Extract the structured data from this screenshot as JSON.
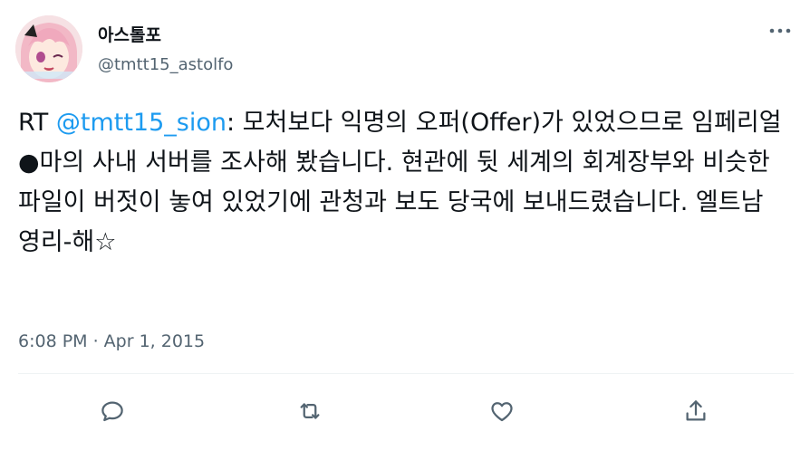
{
  "user": {
    "display_name": "아스톨포",
    "handle": "@tmtt15_astolfo",
    "avatar_icon": "anime-avatar"
  },
  "tweet": {
    "prefix": "RT ",
    "mention": "@tmtt15_sion",
    "body": ": 모처보다 익명의 오퍼(Offer)가 있었으므로 임페리얼 ●마의 사내 서버를 조사해 봤습니다. 현관에 뒷 세계의 회계장부와 비슷한 파일이 버젓이 놓여 있었기에 관청과 보도 당국에 보내드렸습니다. 엘트남 영리-해☆"
  },
  "timestamp": "6:08 PM · Apr 1, 2015",
  "actions": {
    "reply_icon": "reply-icon",
    "retweet_icon": "retweet-icon",
    "like_icon": "like-icon",
    "share_icon": "share-icon"
  },
  "colors": {
    "accent": "#1d9bf0",
    "secondary_text": "#536471",
    "divider": "#eff3f4"
  }
}
